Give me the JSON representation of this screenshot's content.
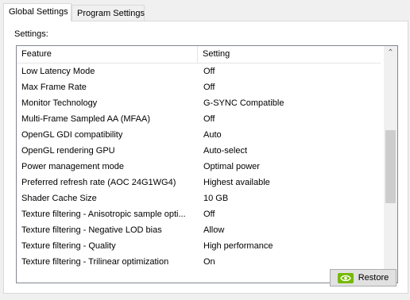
{
  "tabs": [
    {
      "label": "Global Settings"
    },
    {
      "label": "Program Settings"
    }
  ],
  "settings_label": "Settings:",
  "list": {
    "columns": {
      "feature": "Feature",
      "setting": "Setting"
    },
    "rows": [
      {
        "feature": "Low Latency Mode",
        "setting": "Off"
      },
      {
        "feature": "Max Frame Rate",
        "setting": "Off"
      },
      {
        "feature": "Monitor Technology",
        "setting": "G-SYNC Compatible"
      },
      {
        "feature": "Multi-Frame Sampled AA (MFAA)",
        "setting": "Off"
      },
      {
        "feature": "OpenGL GDI compatibility",
        "setting": "Auto"
      },
      {
        "feature": "OpenGL rendering GPU",
        "setting": "Auto-select"
      },
      {
        "feature": "Power management mode",
        "setting": "Optimal power"
      },
      {
        "feature": "Preferred refresh rate (AOC 24G1WG4)",
        "setting": "Highest available"
      },
      {
        "feature": "Shader Cache Size",
        "setting": "10 GB"
      },
      {
        "feature": "Texture filtering - Anisotropic sample opti...",
        "setting": "Off"
      },
      {
        "feature": "Texture filtering - Negative LOD bias",
        "setting": "Allow"
      },
      {
        "feature": "Texture filtering - Quality",
        "setting": "High performance"
      },
      {
        "feature": "Texture filtering - Trilinear optimization",
        "setting": "On"
      }
    ]
  },
  "restore_button": {
    "label": "Restore",
    "icon": "nvidia-logo-icon"
  },
  "colors": {
    "nvidia_green": "#76b900"
  }
}
